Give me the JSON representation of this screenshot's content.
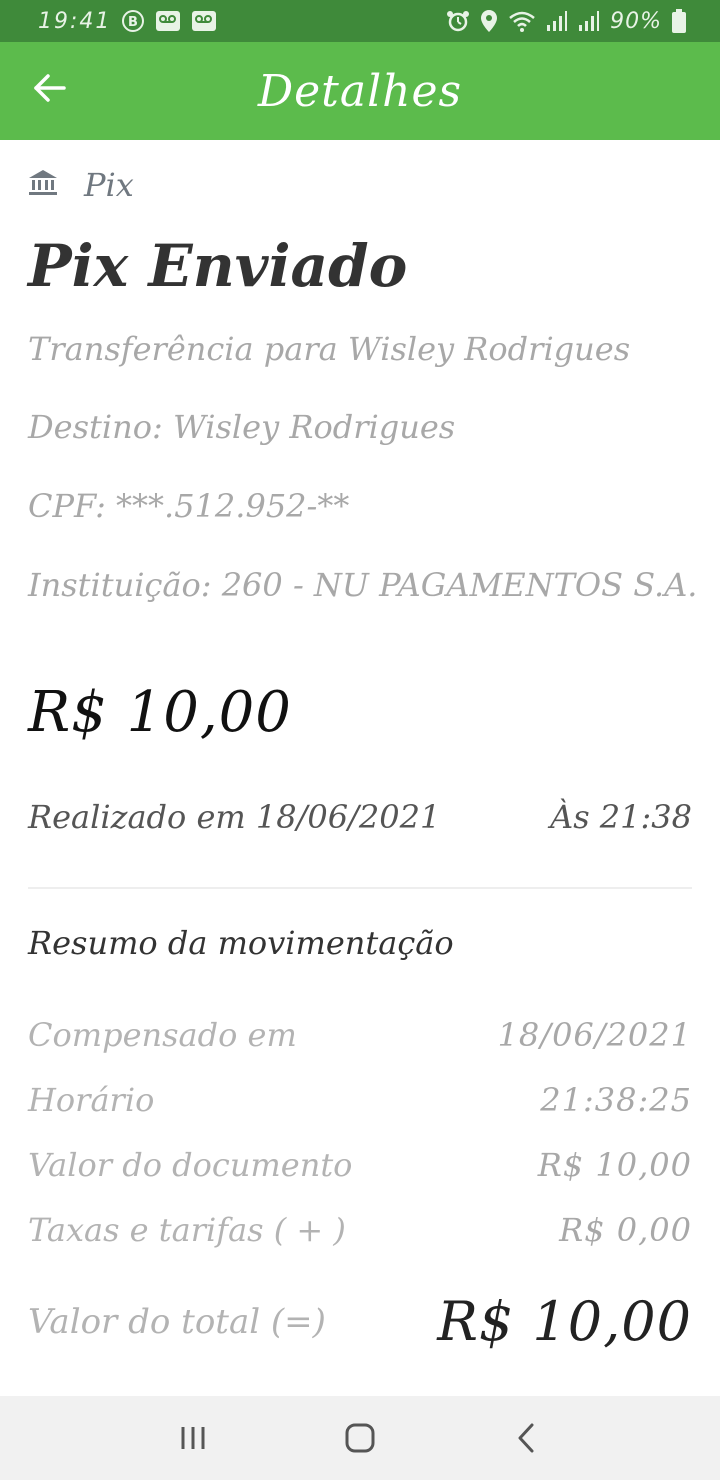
{
  "status_bar": {
    "time": "19:41",
    "battery": "90%",
    "left_icons": [
      "b-icon",
      "voicemail-1-icon",
      "voicemail-2-icon"
    ],
    "right_icons": [
      "alarm-icon",
      "location-icon",
      "wifi-icon",
      "signal-1-icon",
      "signal-2-icon",
      "battery-icon"
    ]
  },
  "app_bar": {
    "title": "Detalhes",
    "background_color": "#5cbb4c"
  },
  "transaction": {
    "category": "Pix",
    "title": "Pix Enviado",
    "description": "Transferência para Wisley Rodrigues",
    "destination": "Destino: Wisley Rodrigues",
    "cpf": "CPF: ***.512.952-**",
    "institution": "Instituição: 260 - NU PAGAMENTOS S.A.",
    "amount": "R$ 10,00",
    "performed_on": "Realizado em 18/06/2021",
    "performed_at": "Às 21:38"
  },
  "summary": {
    "title": "Resumo da movimentação",
    "rows": [
      {
        "label": "Compensado em",
        "value": "18/06/2021"
      },
      {
        "label": "Horário",
        "value": "21:38:25"
      },
      {
        "label": "Valor do documento",
        "value": "R$ 10,00"
      },
      {
        "label": "Taxas e tarifas ( + )",
        "value": "R$ 0,00"
      }
    ],
    "total_label": "Valor do total (=)",
    "total_value": "R$ 10,00"
  },
  "nav_bar": {
    "buttons": [
      "recent-apps-icon",
      "home-icon",
      "back-icon"
    ]
  }
}
